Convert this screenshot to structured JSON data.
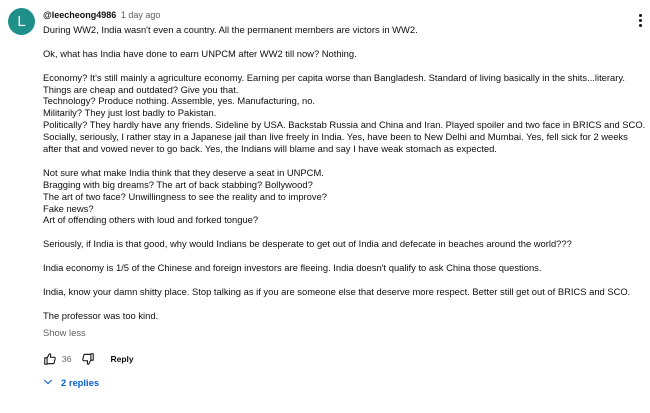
{
  "comment": {
    "avatar_letter": "L",
    "avatar_color": "#1e8f89",
    "author": "@leecheong4986",
    "time": "1 day ago",
    "lines": [
      "During WW2, India wasn't even a country. All the permanent members are victors in WW2.",
      "",
      "Ok, what has India have done to earn UNPCM after WW2 till now? Nothing.",
      "",
      "Economy? It's still mainly a agriculture economy. Earning per capita worse than Bangladesh. Standard of living basically in the shits...literary.",
      "Things are cheap and outdated? Give you that.",
      "Technology? Produce nothing. Assemble, yes. Manufacturing, no.",
      "Militarily? They just lost badly to Pakistan.",
      "Politically? They hardly have any friends. Sideline by USA. Backstab Russia and China and Iran. Played spoiler and two face in BRICS and SCO.",
      "Socially, seriously, I rather stay in a Japanese jail than live freely in India. Yes, have been to New Delhi and Mumbai. Yes, fell sick for 2 weeks",
      "after that and vowed never to go back. Yes, the Indians will blame and say I have weak stomach as expected.",
      "",
      "Not sure what make India think that they deserve a seat in UNPCM.",
      "Bragging with big dreams? The art of back stabbing? Bollywood?",
      "The art of two face? Unwillingness to see the reality and to improve?",
      "Fake news?",
      "Art of offending others with loud and forked tongue?",
      "",
      "Seriously, if India is that good, why would Indians be desperate to get out of India and defecate in beaches around the world???",
      "",
      "India economy is 1/5 of the Chinese and foreign investors are fleeing. India doesn't qualify to ask China those questions.",
      "",
      "India, know your damn shitty place. Stop talking as if you are someone else that deserve more respect. Better still get out of BRICS and SCO.",
      "",
      "The professor was too kind."
    ],
    "show_less": "Show less",
    "like_count": "36",
    "reply_label": "Reply",
    "replies_label": "2 replies",
    "accent_color": "#065fd4"
  },
  "icons": {
    "like": "thumbs-up-icon",
    "dislike": "thumbs-down-icon",
    "menu": "more-vert-icon",
    "expand": "chevron-down-icon"
  }
}
